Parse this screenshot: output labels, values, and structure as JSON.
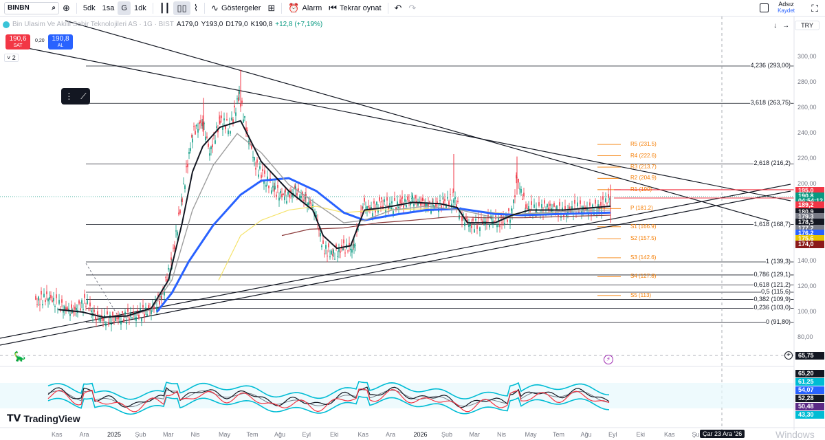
{
  "toolbar": {
    "symbol": "BINBN",
    "intervals": [
      "5dk",
      "1sa",
      "G",
      "1dk"
    ],
    "indicators_label": "Göstergeler",
    "alarm_label": "Alarm",
    "replay_label": "Tekrar oynat",
    "user_name": "Adsız",
    "save_label": "Kaydet"
  },
  "legend": {
    "title": "Bin Ulasim Ve Akilli Sehir Teknolojileri AS · 1G · BIST",
    "open": "A179,0",
    "high": "Y193,0",
    "low": "D179,0",
    "close": "K190,8",
    "change": "+12,8 (+7,19%)"
  },
  "trade": {
    "sell_price": "190,6",
    "sell_label": "SAT",
    "buy_price": "190,8",
    "buy_label": "AL",
    "spread": "0,20",
    "collapse_label": "2"
  },
  "currency": "TRY",
  "price_axis": [
    "300,00",
    "280,00",
    "260,00",
    "240,00",
    "220,00",
    "200,00",
    "180,00",
    "160,00",
    "140,00",
    "120,00",
    "100,00",
    "80,00"
  ],
  "fib_levels": [
    {
      "label": "4,236 (293,00)",
      "price": 293
    },
    {
      "label": "3,618 (263,75)",
      "price": 263.75
    },
    {
      "label": "2,618 (216,2)",
      "price": 216.2
    },
    {
      "label": "1,618 (168,7)",
      "price": 168.7
    },
    {
      "label": "1 (139,3)",
      "price": 139.3
    },
    {
      "label": "0,786 (129,1)",
      "price": 129.1
    },
    {
      "label": "0,618 (121,2)",
      "price": 121.2
    },
    {
      "label": "0,5 (115,6)",
      "price": 115.6
    },
    {
      "label": "0,382 (109,9)",
      "price": 109.9
    },
    {
      "label": "0,236 (103,0)",
      "price": 103.0
    },
    {
      "label": "0 (91,80)",
      "price": 91.8
    }
  ],
  "pivots": [
    {
      "label": "R5 (231.5)",
      "price": 231.5
    },
    {
      "label": "R4 (222.6)",
      "price": 222.6
    },
    {
      "label": "R3 (213.7)",
      "price": 213.7
    },
    {
      "label": "R2 (204.9)",
      "price": 204.9
    },
    {
      "label": "R1 (190)",
      "price": 196
    },
    {
      "label": "P (181.2)",
      "price": 181.2
    },
    {
      "label": "S1 (166.9)",
      "price": 166.9
    },
    {
      "label": "S2 (157.5)",
      "price": 157.5
    },
    {
      "label": "S3 (142.6)",
      "price": 142.6
    },
    {
      "label": "S4 (127.8)",
      "price": 127.8
    },
    {
      "label": "S5 (113)",
      "price": 113
    }
  ],
  "price_tags": [
    {
      "text": "195,0",
      "price": 195.0,
      "color": "#f23645"
    },
    {
      "text": "190,8",
      "price": 190.8,
      "color": "#089981"
    },
    {
      "text": "04:54:12",
      "price": 186.5,
      "color": "#089981"
    },
    {
      "text": "189,2",
      "price": 183.5,
      "color": "#f23645"
    },
    {
      "text": "180,9",
      "price": 178.3,
      "color": "#131722"
    },
    {
      "text": "179,3",
      "price": 174.1,
      "color": "#787b86"
    },
    {
      "text": "178,5",
      "price": 169.8,
      "color": "#131722"
    },
    {
      "text": "177,2",
      "price": 165.4,
      "color": "#787b86"
    },
    {
      "text": "176,2",
      "price": 161.2,
      "color": "#2962ff"
    },
    {
      "text": "175,6",
      "price": 157.0,
      "color": "#e6c300"
    },
    {
      "text": "174,0",
      "price": 152.6,
      "color": "#8b1a1a"
    }
  ],
  "crosshair_price": "65,75",
  "osc_tags": [
    {
      "text": "65,20",
      "color": "#131722"
    },
    {
      "text": "61,25",
      "color": "#00bcd4"
    },
    {
      "text": "54,07",
      "color": "#2962ff"
    },
    {
      "text": "52,28",
      "color": "#131722"
    },
    {
      "text": "50,48",
      "color": "#5b2a86"
    },
    {
      "text": "43,30",
      "color": "#00bcd4"
    }
  ],
  "time_axis": [
    "Kas",
    "Ara",
    "2025",
    "Şub",
    "Mar",
    "Nis",
    "May",
    "Tem",
    "Ağu",
    "Eyl",
    "Eki",
    "Kas",
    "Ara",
    "2026",
    "Şub",
    "Mar",
    "Nis",
    "May",
    "Tem",
    "Ağu",
    "Eyl",
    "Eki",
    "Kas",
    "Şub"
  ],
  "date_cursor": "Çar 23 Ara '26",
  "branding": "TradingView",
  "watermark": "Windows"
}
